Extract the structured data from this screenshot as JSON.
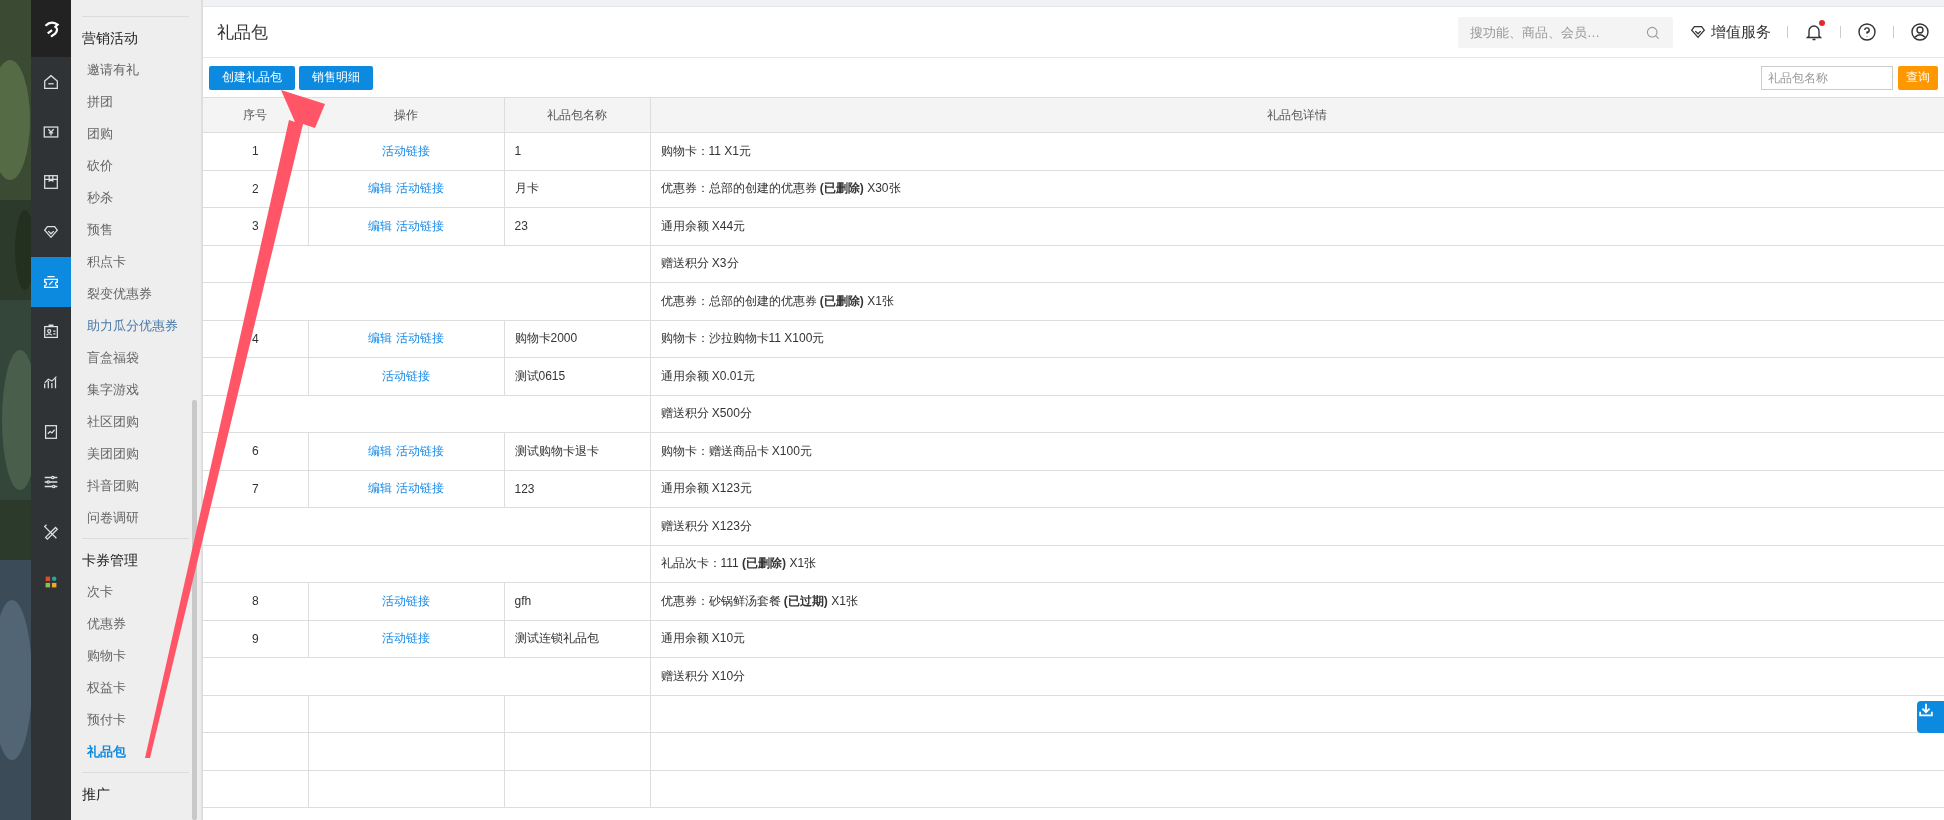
{
  "rail_items": [
    {
      "kind": "home",
      "selected": false
    },
    {
      "kind": "money",
      "selected": false
    },
    {
      "kind": "box",
      "selected": false
    },
    {
      "kind": "diamond",
      "selected": false
    },
    {
      "kind": "ticket",
      "selected": true
    },
    {
      "kind": "id-card",
      "selected": false
    },
    {
      "kind": "chart",
      "selected": false
    },
    {
      "kind": "report",
      "selected": false
    },
    {
      "kind": "sliders",
      "selected": false
    },
    {
      "kind": "tools",
      "selected": false
    },
    {
      "kind": "apps",
      "selected": false
    }
  ],
  "sidebar": {
    "groups": [
      {
        "title": "营销活动",
        "items": [
          {
            "label": "邀请有礼",
            "selected": false,
            "hovered": false
          },
          {
            "label": "拼团",
            "selected": false,
            "hovered": false
          },
          {
            "label": "团购",
            "selected": false,
            "hovered": false
          },
          {
            "label": "砍价",
            "selected": false,
            "hovered": false
          },
          {
            "label": "秒杀",
            "selected": false,
            "hovered": false
          },
          {
            "label": "预售",
            "selected": false,
            "hovered": false
          },
          {
            "label": "积点卡",
            "selected": false,
            "hovered": false
          },
          {
            "label": "裂变优惠券",
            "selected": false,
            "hovered": false
          },
          {
            "label": "助力瓜分优惠券",
            "selected": false,
            "hovered": true
          },
          {
            "label": "盲盒福袋",
            "selected": false,
            "hovered": false
          },
          {
            "label": "集字游戏",
            "selected": false,
            "hovered": false
          },
          {
            "label": "社区团购",
            "selected": false,
            "hovered": false
          },
          {
            "label": "美团团购",
            "selected": false,
            "hovered": false
          },
          {
            "label": "抖音团购",
            "selected": false,
            "hovered": false
          },
          {
            "label": "问卷调研",
            "selected": false,
            "hovered": false
          }
        ]
      },
      {
        "title": "卡券管理",
        "items": [
          {
            "label": "次卡",
            "selected": false,
            "hovered": false
          },
          {
            "label": "优惠券",
            "selected": false,
            "hovered": false
          },
          {
            "label": "购物卡",
            "selected": false,
            "hovered": false
          },
          {
            "label": "权益卡",
            "selected": false,
            "hovered": false
          },
          {
            "label": "预付卡",
            "selected": false,
            "hovered": false
          },
          {
            "label": "礼品包",
            "selected": true,
            "hovered": false
          }
        ]
      },
      {
        "title": "推广"
      }
    ]
  },
  "header": {
    "title": "礼品包",
    "search": {
      "placeholder": "搜功能、商品、会员…"
    },
    "value_service": "增值服务",
    "notification_dot": true
  },
  "toolbar": {
    "buttons": [
      "创建礼品包",
      "销售明细"
    ],
    "name_filter": {
      "placeholder": "礼品包名称"
    },
    "query_button": "查询"
  },
  "table": {
    "columns": [
      "序号",
      "操作",
      "礼品包名称",
      "礼品包详情"
    ],
    "rows": [
      {
        "kind": "item",
        "number": "1",
        "actions": [
          "活动链接"
        ],
        "name": "1",
        "detail": "购物卡：11 X1元"
      },
      {
        "kind": "item",
        "number": "2",
        "actions": [
          "编辑",
          "活动链接"
        ],
        "name": "月卡",
        "detail": "优惠券：总部的创建的优惠券 **(已删除)** X30张"
      },
      {
        "kind": "item",
        "number": "3",
        "actions": [
          "编辑",
          "活动链接"
        ],
        "name": "23",
        "detail": "通用余额 X44元"
      },
      {
        "kind": "extra",
        "detail": "赠送积分 X3分"
      },
      {
        "kind": "extra",
        "detail": "优惠券：总部的创建的优惠券 **(已删除)** X1张"
      },
      {
        "kind": "item",
        "number": "4",
        "actions": [
          "编辑",
          "活动链接"
        ],
        "name": "购物卡2000",
        "detail": "购物卡：沙拉购物卡11 X100元"
      },
      {
        "kind": "item",
        "actions": [
          "活动链接"
        ],
        "name": "测试0615",
        "detail": "通用余额 X0.01元"
      },
      {
        "kind": "extra",
        "detail": "赠送积分 X500分"
      },
      {
        "kind": "item",
        "number": "6",
        "actions": [
          "编辑",
          "活动链接"
        ],
        "name": "测试购物卡退卡",
        "detail": "购物卡：赠送商品卡 X100元"
      },
      {
        "kind": "item",
        "number": "7",
        "actions": [
          "编辑",
          "活动链接"
        ],
        "name": "123",
        "detail": "通用余额 X123元"
      },
      {
        "kind": "extra",
        "detail": "赠送积分 X123分"
      },
      {
        "kind": "extra",
        "detail": "礼品次卡：111 **(已删除)** X1张"
      },
      {
        "kind": "item",
        "number": "8",
        "actions": [
          "活动链接"
        ],
        "name": "gfh",
        "detail": "优惠券：砂锅鲜汤套餐 **(已过期)** X1张"
      },
      {
        "kind": "item",
        "number": "9",
        "actions": [
          "活动链接"
        ],
        "name": "测试连锁礼品包",
        "detail": "通用余额 X10元"
      },
      {
        "kind": "extra",
        "detail": "赠送积分 X10分"
      },
      {
        "kind": "empty"
      },
      {
        "kind": "empty"
      },
      {
        "kind": "empty"
      }
    ]
  }
}
